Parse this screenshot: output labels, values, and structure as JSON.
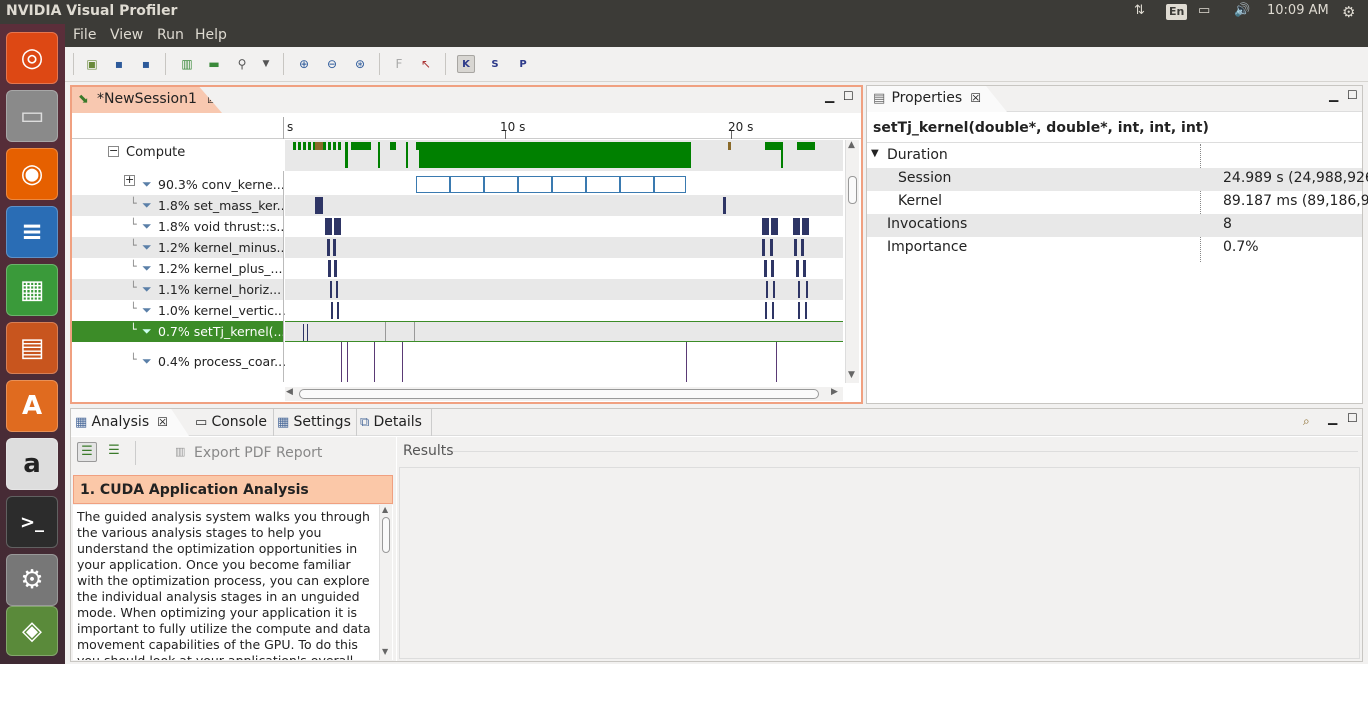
{
  "window": {
    "title": "NVIDIA Visual Profiler"
  },
  "tray": {
    "lang": "En",
    "time": "10:09 AM"
  },
  "menu": [
    "File",
    "View",
    "Run",
    "Help"
  ],
  "session_tab": {
    "label": "*NewSession1"
  },
  "ruler": {
    "labels": [
      "s",
      "10 s",
      "20 s"
    ]
  },
  "timeline": {
    "group_label": "Compute",
    "rows": [
      {
        "label": "90.3% conv_kerne...",
        "selected": false
      },
      {
        "label": "1.8% set_mass_ker...",
        "selected": false
      },
      {
        "label": "1.8% void thrust::s...",
        "selected": false
      },
      {
        "label": "1.2% kernel_minus...",
        "selected": false
      },
      {
        "label": "1.2% kernel_plus_...",
        "selected": false
      },
      {
        "label": "1.1% kernel_horiz...",
        "selected": false
      },
      {
        "label": "1.0% kernel_vertic...",
        "selected": false
      },
      {
        "label": "0.7% setTj_kernel(...",
        "selected": true
      },
      {
        "label": "0.4% process_coar...",
        "selected": false
      }
    ]
  },
  "properties": {
    "tab_label": "Properties",
    "heading": "setTj_kernel(double*, double*, int, int, int)",
    "rows": [
      {
        "label": "Duration",
        "value": ""
      },
      {
        "label": "Session",
        "value": "24.989 s (24,988,926"
      },
      {
        "label": "Kernel",
        "value": "89.187 ms (89,186,94"
      },
      {
        "label": "Invocations",
        "value": "8"
      },
      {
        "label": "Importance",
        "value": "0.7%"
      }
    ]
  },
  "bottom_tabs": [
    "Analysis",
    "Console",
    "Settings",
    "Details"
  ],
  "analysis": {
    "export_label": "Export PDF Report",
    "results_label": "Results",
    "section_title": "1. CUDA Application Analysis",
    "body": "The guided analysis system walks you through the various analysis stages to help you understand the optimization opportunities in your application. Once you become familiar with the optimization process, you can explore the individual analysis stages in an unguided mode. When optimizing your application it is important to fully utilize the compute and data movement capabilities of the GPU. To do this you should look at your application's overall GPU"
  },
  "colors": {
    "accent": "#f8c8b0",
    "selected_row": "#3c8c28",
    "kernel_bar": "#008000",
    "mark_dark": "#2e3565"
  }
}
